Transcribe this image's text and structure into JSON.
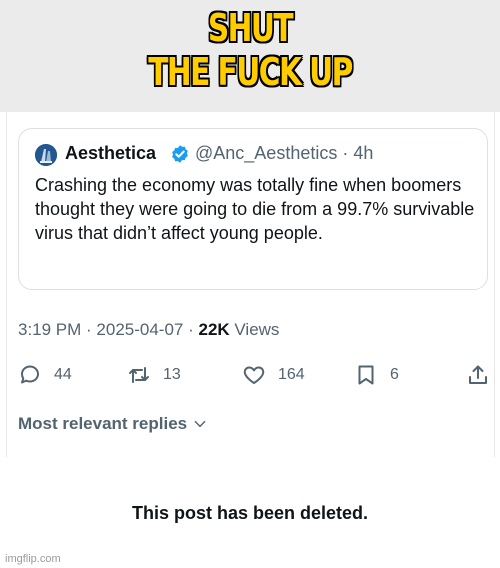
{
  "meme": {
    "caption_line1": "SHUT",
    "caption_line2": "THE FUCK UP"
  },
  "quoted_post": {
    "display_name": "Aesthetica",
    "handle_time": "@Anc_Aesthetics · 4h",
    "verified_icon": "verified-badge-icon",
    "text": "Crashing the economy was totally fine when boomers thought they were going to die from a 99.7% survivable virus that didn’t affect young people."
  },
  "post_meta": {
    "time_date": "3:19 PM · 2025-04-07 · ",
    "views_count": "22K",
    "views_label": " Views"
  },
  "actions": {
    "replies": "44",
    "reposts": "13",
    "likes": "164",
    "bookmarks": "6"
  },
  "replies_sort": {
    "label": "Most relevant replies"
  },
  "deleted_notice": "This post has been deleted.",
  "watermark": "imgflip.com",
  "colors": {
    "caption_fill": "#ffcc00",
    "caption_outline": "#000000",
    "verified_blue": "#1d9bf0",
    "muted_text": "#536471",
    "band_background": "#ebebeb"
  }
}
